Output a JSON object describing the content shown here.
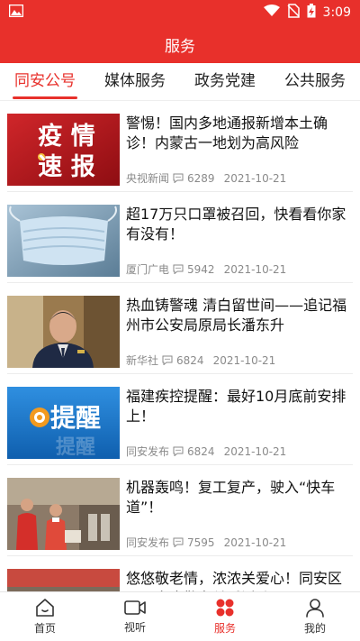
{
  "status": {
    "time": "3:09"
  },
  "header": {
    "title": "服务"
  },
  "tabs": [
    {
      "label": "同安公号",
      "active": true
    },
    {
      "label": "媒体服务",
      "active": false
    },
    {
      "label": "政务党建",
      "active": false
    },
    {
      "label": "公共服务",
      "active": false
    }
  ],
  "thumbs": {
    "t0": {
      "line1": "疫 情",
      "line2": "速 报"
    },
    "t3": {
      "word": "提醒",
      "ghost": "提醒"
    }
  },
  "news": [
    {
      "title": "警惕！国内多地通报新增本土确诊！内蒙古一地划为高风险",
      "source": "央视新闻",
      "comments": "6289",
      "date": "2021-10-21"
    },
    {
      "title": "超17万只口罩被召回，快看看你家有没有！",
      "source": "厦门广电",
      "comments": "5942",
      "date": "2021-10-21"
    },
    {
      "title": "热血铸警魂 清白留世间——追记福州市公安局原局长潘东升",
      "source": "新华社",
      "comments": "6824",
      "date": "2021-10-21"
    },
    {
      "title": "福建疾控提醒：最好10月底前安排上！",
      "source": "同安发布",
      "comments": "6824",
      "date": "2021-10-21"
    },
    {
      "title": "机器轰鸣！复工复产，驶入“快车道”！",
      "source": "同安发布",
      "comments": "7595",
      "date": "2021-10-21"
    },
    {
      "title": "悠悠敬老情，浓浓关爱心！同安区开展家庭敬老关爱活动",
      "source": "",
      "comments": "",
      "date": ""
    }
  ],
  "nav": [
    {
      "label": "首页",
      "icon": "home-icon",
      "active": false
    },
    {
      "label": "视听",
      "icon": "video-icon",
      "active": false
    },
    {
      "label": "服务",
      "icon": "service-dots-icon",
      "active": true
    },
    {
      "label": "我的",
      "icon": "user-icon",
      "active": false
    }
  ],
  "colors": {
    "accent": "#e8302b",
    "meta": "#8a8a8a"
  }
}
